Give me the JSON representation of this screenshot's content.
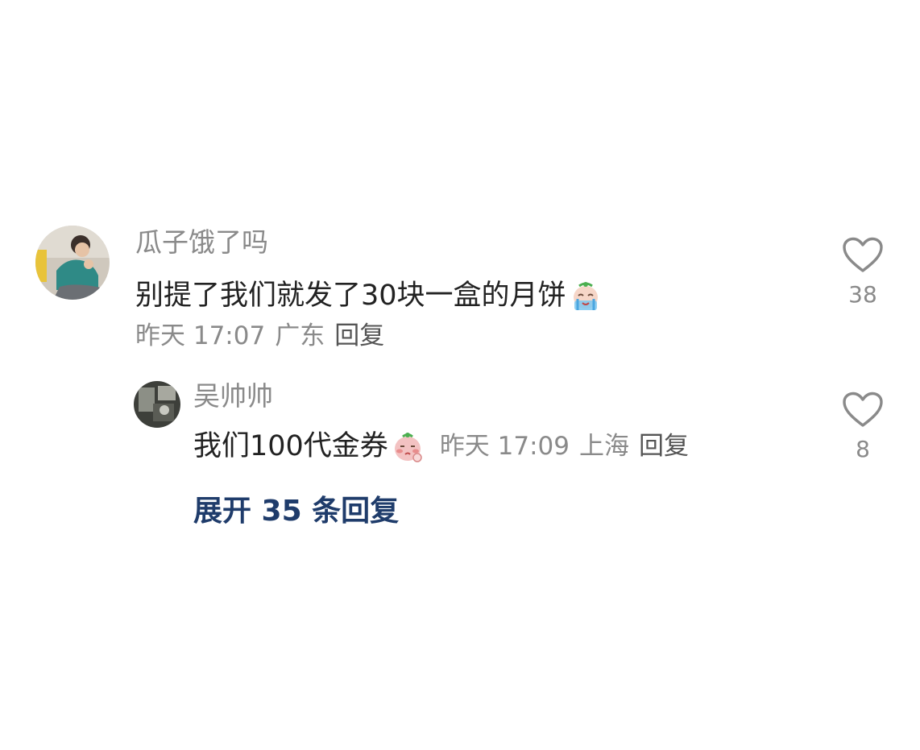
{
  "comment": {
    "username": "瓜子饿了吗",
    "text": "别提了我们就发了30块一盒的月饼",
    "emoji": "crying-emoji",
    "time": "昨天 17:07",
    "location": "广东",
    "reply_label": "回复",
    "like_count": "38"
  },
  "reply": {
    "username": "吴帅帅",
    "text": "我们100代金券",
    "emoji": "shy-emoji",
    "time": "昨天 17:09",
    "location": "上海",
    "reply_label": "回复",
    "like_count": "8"
  },
  "expand_label": "展开 35 条回复",
  "colors": {
    "meta_gray": "#8a8a8a",
    "text_dark": "#222222",
    "link_blue": "#1f3c6b"
  }
}
